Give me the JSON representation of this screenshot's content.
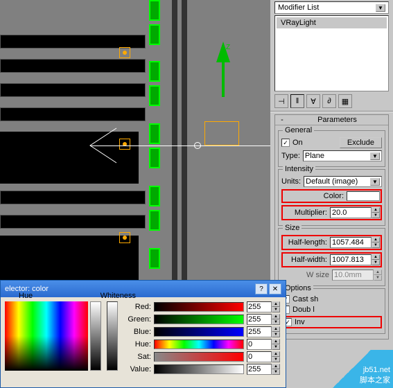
{
  "viewport": {
    "axis_label": "Z"
  },
  "modifier_panel": {
    "list_label": "Modifier List",
    "stack_item": "VRayLight"
  },
  "rollout": {
    "collapse": "-",
    "title": "Parameters"
  },
  "general": {
    "group": "General",
    "on_label": "On",
    "on_checked": "✓",
    "exclude": "Exclude",
    "type_label": "Type:",
    "type_value": "Plane"
  },
  "intensity": {
    "group": "Intensity",
    "units_label": "Units:",
    "units_value": "Default (image)",
    "color_label": "Color:",
    "multiplier_label": "Multiplier:",
    "multiplier_value": "20.0"
  },
  "size": {
    "group": "Size",
    "half_length_label": "Half-length:",
    "half_length_value": "1057.484",
    "half_width_label": "Half-width:",
    "half_width_value": "1007.813",
    "w_size_label": "W size",
    "w_size_value": "10.0mm"
  },
  "options": {
    "group": "Options",
    "cast": "Cast sh",
    "doub": "Doub l",
    "inv": "Inv",
    "checked": "✓"
  },
  "color_dialog": {
    "title": "elector: color",
    "hue_label": "Hue",
    "whiteness_label": "Whiteness",
    "red": "Red:",
    "green": "Green:",
    "blue": "Blue:",
    "hue": "Hue:",
    "sat": "Sat:",
    "value": "Value:",
    "v_red": "255",
    "v_green": "255",
    "v_blue": "255",
    "v_hue": "0",
    "v_sat": "0",
    "v_value": "255"
  },
  "watermark": {
    "line1": "jb51.net",
    "line2": "脚本之家"
  },
  "chart_data": null
}
